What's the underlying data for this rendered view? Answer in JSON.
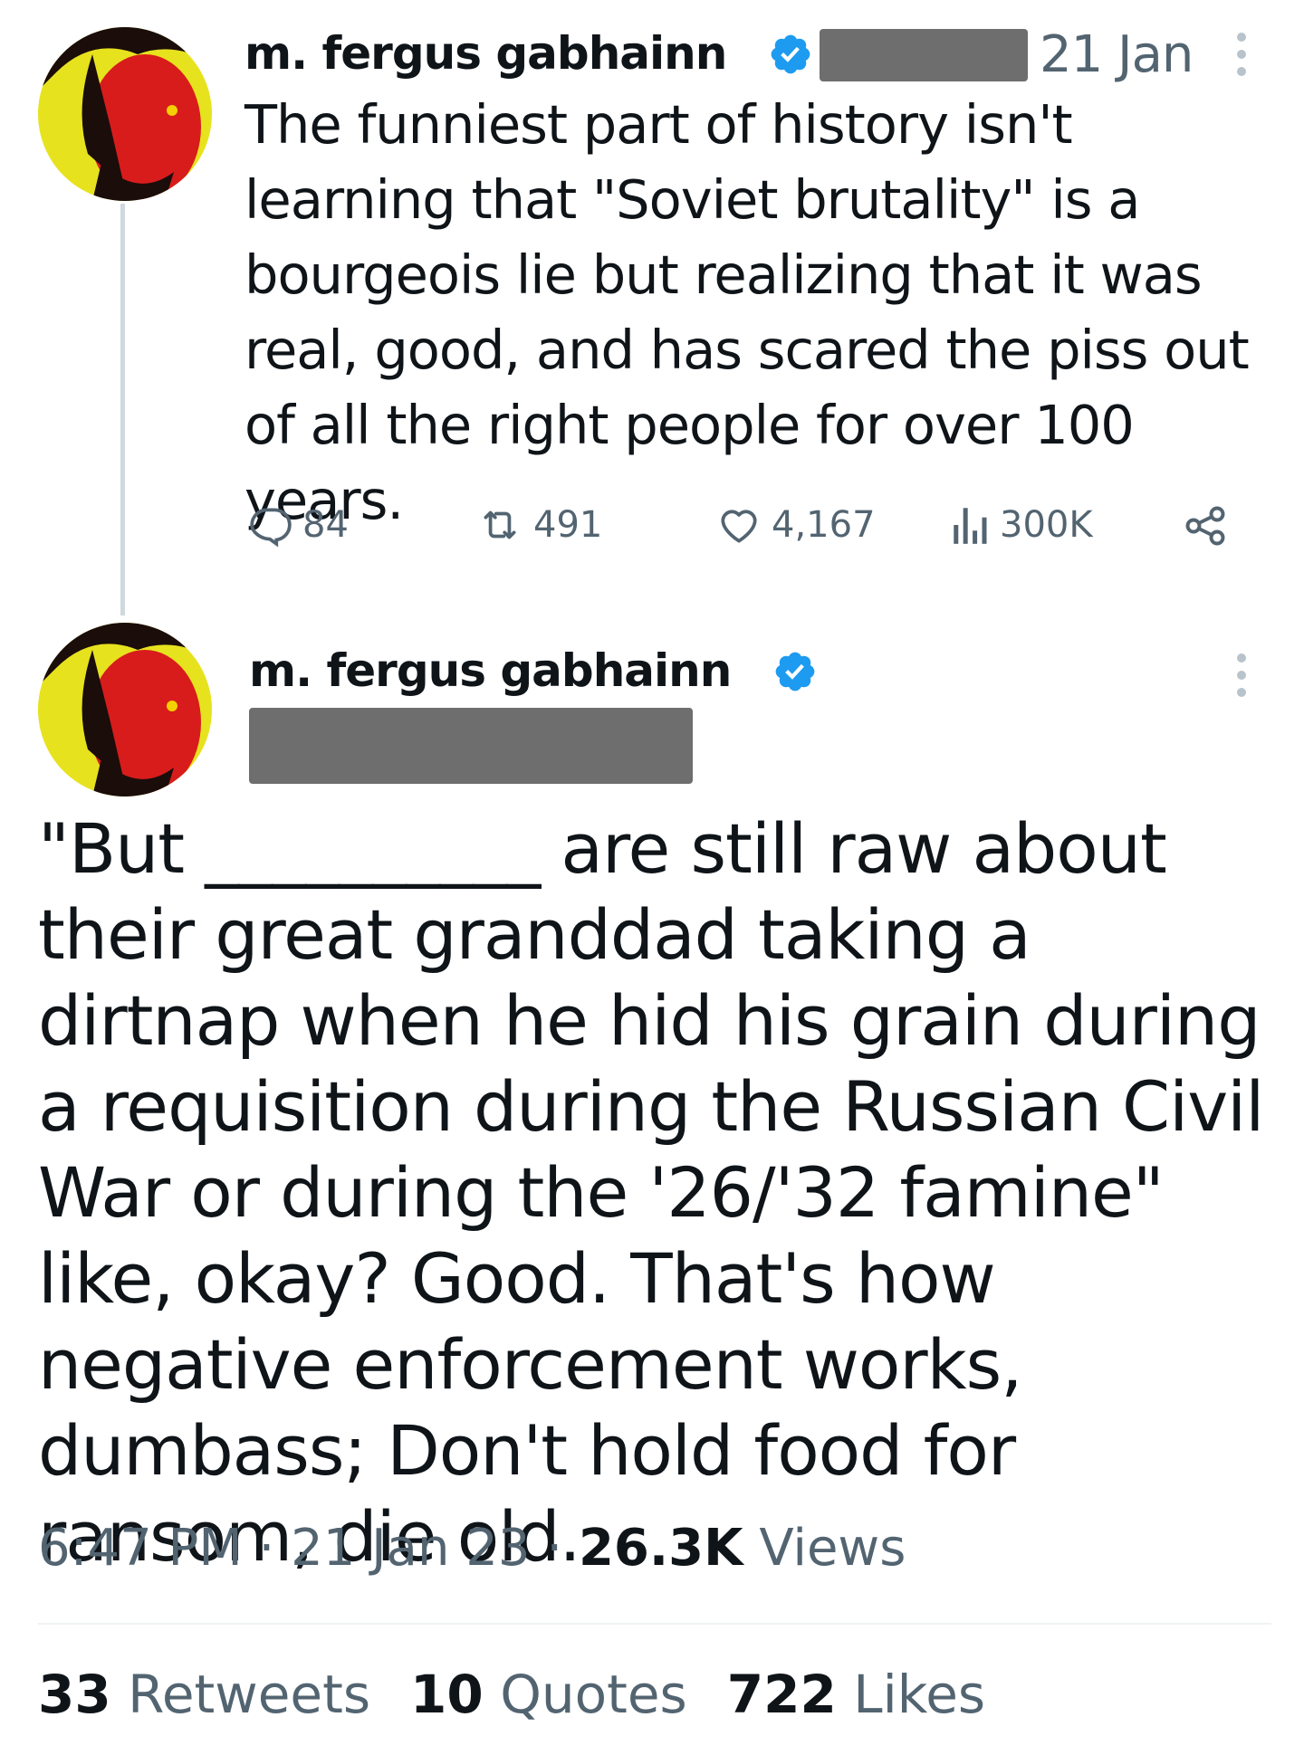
{
  "tweet1": {
    "author_name": "m. fergus gabhainn",
    "date": "21 Jan",
    "body": "The funniest part of history isn't learning that \"Soviet brutality\" is a bourgeois lie but realizing that it was real, good, and has scared the piss out of all the right people for over 100 years.",
    "actions": {
      "replies": "84",
      "retweets": "491",
      "likes": "4,167",
      "views": "300K"
    }
  },
  "tweet2": {
    "author_name": "m. fergus gabhainn",
    "body": "\"But __________ are still raw about their great granddad taking a dirtnap when he hid his grain during a requisition during the Russian Civil War or during the '26/'32 famine\" like, okay?  Good. That's how negative enforcement works, dumbass; Don't hold food for ransom, die old.",
    "time": "6:47 PM",
    "date": "21 Jan 23",
    "views_count": "26.3K",
    "views_label": "Views",
    "separator": "·",
    "stats": {
      "retweets_count": "33",
      "retweets_label": "Retweets",
      "quotes_count": "10",
      "quotes_label": "Quotes",
      "likes_count": "722",
      "likes_label": "Likes"
    }
  },
  "colors": {
    "verified_badge": "#1d9bf0",
    "muted_text": "#536471",
    "text": "#0f1419",
    "redaction": "#6e6e6e"
  },
  "icons": [
    "verified-badge-icon",
    "more-options-icon",
    "reply-icon",
    "retweet-icon",
    "like-icon",
    "views-icon",
    "share-icon"
  ]
}
